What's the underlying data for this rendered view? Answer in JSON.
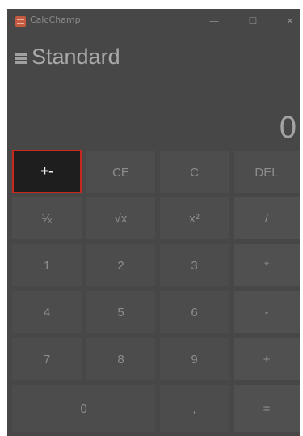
{
  "window": {
    "title": "CalcChamp",
    "controls": {
      "minimize": "—",
      "maximize": "☐",
      "close": "✕"
    }
  },
  "header": {
    "mode": "Standard"
  },
  "display": {
    "value": "0"
  },
  "keys": {
    "negate": "+-",
    "ce": "CE",
    "c": "C",
    "del": "DEL",
    "reciprocal": "¹⁄ₓ",
    "sqrt": "√x",
    "square": "x²",
    "divide": "/",
    "n1": "1",
    "n2": "2",
    "n3": "3",
    "multiply": "*",
    "n4": "4",
    "n5": "5",
    "n6": "6",
    "subtract": "-",
    "n7": "7",
    "n8": "8",
    "n9": "9",
    "add": "+",
    "n0": "0",
    "decimal": ",",
    "equals": "="
  },
  "colors": {
    "background": "#474747",
    "highlight_border": "#c8281d",
    "active_key": "#1e1e1e"
  }
}
